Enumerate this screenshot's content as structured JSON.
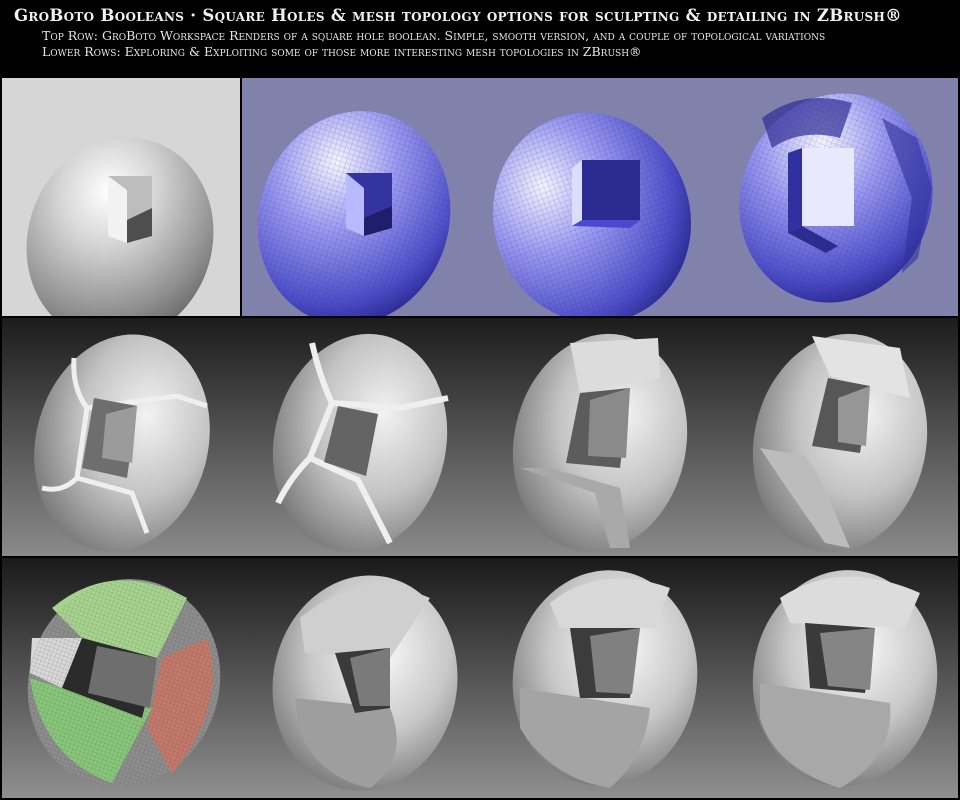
{
  "header": {
    "title": "GroBoto Booleans · Square Holes & mesh topology options for sculpting & detailing in ZBrush®",
    "line1": "Top Row: GroBoto Workspace Renders of a square hole boolean. Simple, smooth version, and a couple of topological variations",
    "line2": "Lower Rows: Exploring & Exploiting some of those more interesting mesh topologies in ZBrush®"
  },
  "colors": {
    "background": "#000000",
    "top_left_bg": "#d8d8d8",
    "top_row_bg": "#7d80a8",
    "mesh_blue": "#7c7cf0",
    "gray_shaded": "#c9c9c9",
    "polygroup_green": "#9fd08a",
    "polygroup_red": "#c0796a"
  },
  "renders": [
    {
      "id": "r1-smooth-sphere",
      "style": "gray-smooth"
    },
    {
      "id": "r1-blue-mesh-1",
      "style": "blue-mesh"
    },
    {
      "id": "r1-blue-mesh-2",
      "style": "blue-mesh"
    },
    {
      "id": "r1-blue-mesh-3",
      "style": "blue-mesh-split"
    },
    {
      "id": "r2-sculpt-1",
      "style": "gray-panels"
    },
    {
      "id": "r2-sculpt-2",
      "style": "gray-panels"
    },
    {
      "id": "r2-sculpt-3",
      "style": "gray-panels"
    },
    {
      "id": "r2-sculpt-4",
      "style": "gray-panels"
    },
    {
      "id": "r3-polygroups",
      "style": "polygroups"
    },
    {
      "id": "r3-sculpt-2",
      "style": "gray-split"
    },
    {
      "id": "r3-sculpt-3",
      "style": "gray-split"
    },
    {
      "id": "r3-sculpt-4",
      "style": "gray-split"
    }
  ]
}
